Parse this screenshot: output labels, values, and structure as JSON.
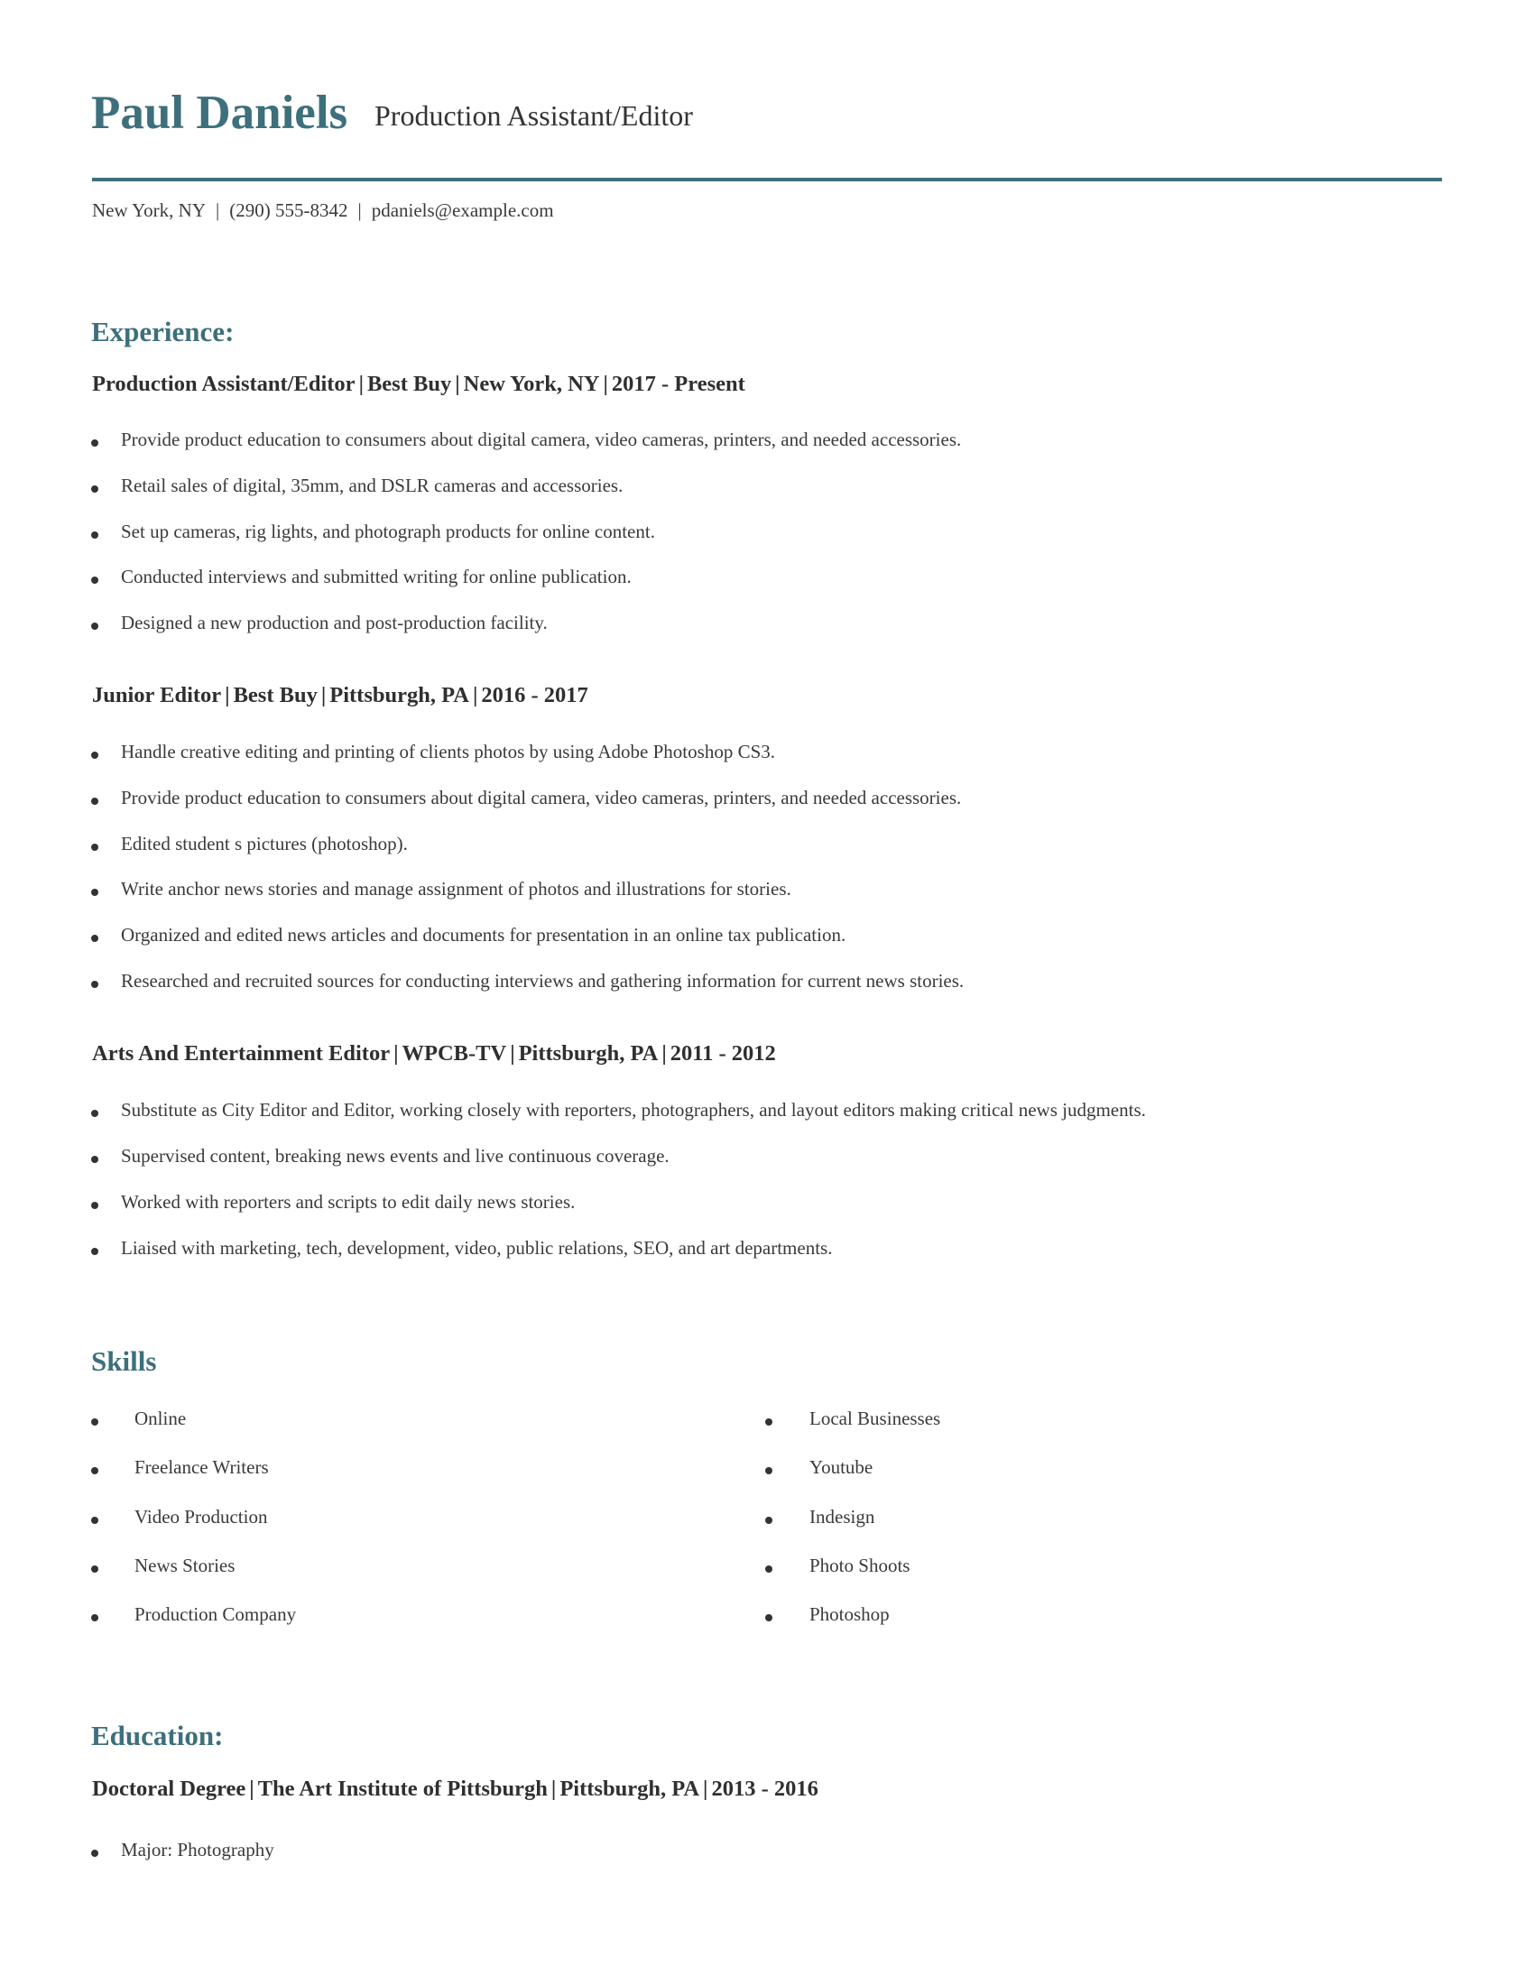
{
  "header": {
    "name": "Paul Daniels",
    "title": "Production Assistant/Editor",
    "contact": {
      "location": "New York, NY",
      "phone": "(290) 555-8342",
      "email": "pdaniels@example.com",
      "separator": "|"
    }
  },
  "accent_color": "#3d6f7c",
  "experience": {
    "heading": "Experience:",
    "jobs": [
      {
        "role": "Production Assistant/Editor",
        "company": "Best Buy",
        "location": "New York, NY",
        "dates": "2017 - Present",
        "bullets": [
          "Provide product education to consumers about digital camera, video cameras, printers, and needed accessories.",
          "Retail sales of digital, 35mm, and DSLR cameras and accessories.",
          "Set up cameras, rig lights, and photograph products for online content.",
          "Conducted interviews and submitted writing for online publication.",
          "Designed a new production and post-production facility."
        ]
      },
      {
        "role": "Junior Editor",
        "company": "Best Buy",
        "location": "Pittsburgh, PA",
        "dates": "2016 - 2017",
        "bullets": [
          "Handle creative editing and printing of clients photos by using Adobe Photoshop CS3.",
          "Provide product education to consumers about digital camera, video cameras, printers, and needed accessories.",
          "Edited student s pictures (photoshop).",
          "Write anchor news stories and manage assignment of photos and illustrations for stories.",
          "Organized and edited news articles and documents for presentation in an online tax publication.",
          "Researched and recruited sources for conducting interviews and gathering information for current news stories."
        ]
      },
      {
        "role": "Arts And Entertainment Editor",
        "company": "WPCB-TV",
        "location": "Pittsburgh, PA",
        "dates": "2011 - 2012",
        "bullets": [
          "Substitute as City Editor and Editor, working closely with reporters, photographers, and layout editors making critical news judgments.",
          "Supervised content, breaking news events and live continuous coverage.",
          "Worked with reporters and scripts to edit daily news stories.",
          "Liaised with marketing, tech, development, video, public relations, SEO, and art departments."
        ]
      }
    ]
  },
  "skills": {
    "heading": "Skills",
    "left": [
      "Online",
      "Freelance Writers",
      "Video Production",
      "News Stories",
      "Production Company"
    ],
    "right": [
      "Local Businesses",
      "Youtube",
      "Indesign",
      "Photo Shoots",
      "Photoshop"
    ]
  },
  "education": {
    "heading": "Education:",
    "entries": [
      {
        "degree": "Doctoral Degree",
        "school": "The Art Institute of Pittsburgh",
        "location": "Pittsburgh, PA",
        "dates": "2013 - 2016",
        "bullets": [
          "Major: Photography"
        ]
      }
    ]
  }
}
